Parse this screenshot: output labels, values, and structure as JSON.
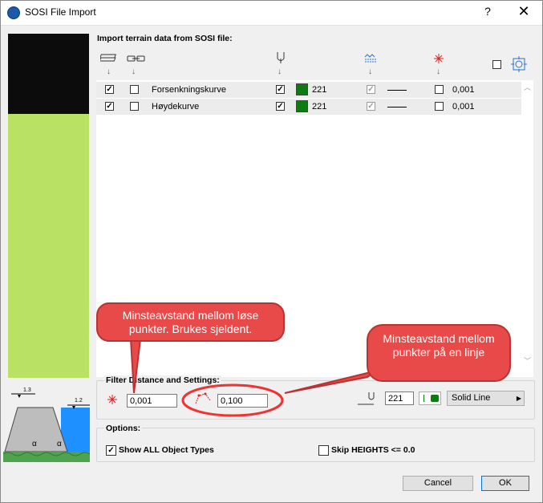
{
  "window": {
    "title": "SOSI File Import",
    "help": "?",
    "close": "✕"
  },
  "import_section": {
    "label": "Import terrain data from SOSI file:"
  },
  "columns": {
    "arrow": "↓"
  },
  "rows": [
    {
      "import": true,
      "link": false,
      "name": "Forsenkningskurve",
      "pen_on": true,
      "pen": "221",
      "linetype_on": true,
      "filter_on": false,
      "filter": "0,001"
    },
    {
      "import": true,
      "link": false,
      "name": "Høydekurve",
      "pen_on": true,
      "pen": "221",
      "linetype_on": true,
      "filter_on": false,
      "filter": "0,001"
    }
  ],
  "filter_section": {
    "label": "Filter Distance and Settings:",
    "point_distance": "0,001",
    "line_distance": "0,100",
    "pen": "221",
    "line_type": "Solid Line"
  },
  "options": {
    "label": "Options:",
    "show_all": {
      "label": "Show ALL Object Types",
      "checked": true
    },
    "skip_heights": {
      "label": "Skip HEIGHTS <= 0.0",
      "checked": false
    }
  },
  "buttons": {
    "cancel": "Cancel",
    "ok": "OK"
  },
  "callouts": {
    "left": "Minsteavstand mellom løse punkter. Brukes sjeldent.",
    "right": "Minsteavstand mellom punkter på en linje"
  },
  "diagram": {
    "label_top_left": "1.3",
    "label_top_right": "1.2",
    "alpha": "α"
  },
  "colors": {
    "pen_swatch": "#0d7a12",
    "callout": "#e84a4a",
    "preview_green": "#b9e164"
  }
}
